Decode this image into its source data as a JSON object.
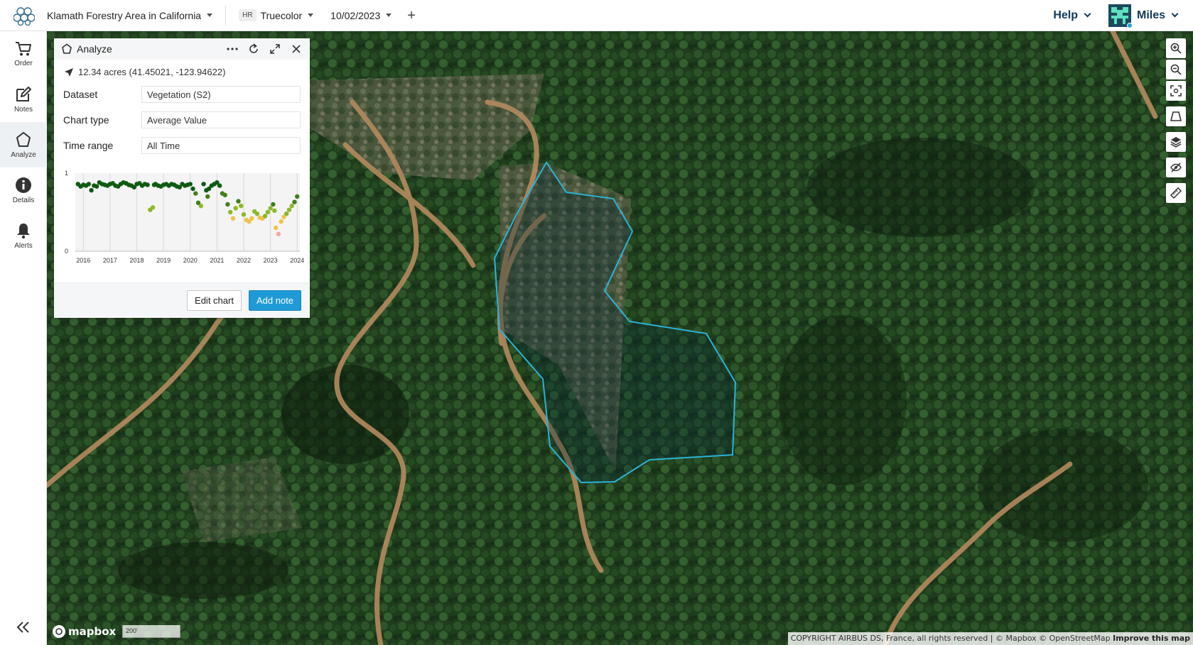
{
  "topbar": {
    "project": "Klamath Forestry Area in California",
    "layer_badge": "HR",
    "layer": "Truecolor",
    "date": "10/02/2023",
    "add_label": "+",
    "help": "Help",
    "user": "Miles"
  },
  "sidebar": {
    "items": [
      {
        "label": "Order",
        "icon": "cart-icon"
      },
      {
        "label": "Notes",
        "icon": "edit-icon"
      },
      {
        "label": "Analyze",
        "icon": "pentagon-icon",
        "active": true
      },
      {
        "label": "Details",
        "icon": "info-icon"
      },
      {
        "label": "Alerts",
        "icon": "bell-icon"
      }
    ],
    "collapse_icon": "double-chevron-left-icon"
  },
  "panel": {
    "title": "Analyze",
    "area": "12.34 acres (41.45021, -123.94622)",
    "fields": [
      {
        "label": "Dataset",
        "value": "Vegetation (S2)"
      },
      {
        "label": "Chart type",
        "value": "Average Value"
      },
      {
        "label": "Time range",
        "value": "All Time"
      }
    ],
    "buttons": {
      "edit": "Edit chart",
      "add_note": "Add note"
    }
  },
  "chart_data": {
    "type": "scatter",
    "title": "",
    "xlabel": "",
    "ylabel": "",
    "xlim": [
      2015.7,
      2024.1
    ],
    "ylim": [
      0,
      1
    ],
    "y_ticks": [
      "0",
      "1"
    ],
    "x_ticks": [
      "2016",
      "2017",
      "2018",
      "2019",
      "2020",
      "2021",
      "2022",
      "2023",
      "2024"
    ],
    "grid": true,
    "colors": {
      "high": "#0f5a12",
      "mid": "#8cb82a",
      "low": "#f0c24a",
      "lowest": "#f5a9a0"
    },
    "x": [
      2015.8,
      2015.9,
      2016.0,
      2016.1,
      2016.2,
      2016.3,
      2016.4,
      2016.5,
      2016.6,
      2016.7,
      2016.8,
      2016.9,
      2017.0,
      2017.1,
      2017.2,
      2017.3,
      2017.4,
      2017.5,
      2017.6,
      2017.7,
      2017.8,
      2017.9,
      2018.0,
      2018.1,
      2018.2,
      2018.3,
      2018.4,
      2018.5,
      2018.6,
      2018.65,
      2018.7,
      2018.8,
      2018.9,
      2019.0,
      2019.1,
      2019.2,
      2019.3,
      2019.4,
      2019.5,
      2019.6,
      2019.7,
      2019.8,
      2019.9,
      2020.0,
      2020.1,
      2020.2,
      2020.3,
      2020.4,
      2020.5,
      2020.6,
      2020.65,
      2020.7,
      2020.8,
      2020.9,
      2021.0,
      2021.1,
      2021.2,
      2021.3,
      2021.4,
      2021.5,
      2021.6,
      2021.7,
      2021.8,
      2021.9,
      2022.0,
      2022.1,
      2022.2,
      2022.3,
      2022.4,
      2022.5,
      2022.6,
      2022.7,
      2022.8,
      2022.9,
      2023.0,
      2023.1,
      2023.15,
      2023.2,
      2023.3,
      2023.4,
      2023.5,
      2023.6,
      2023.7,
      2023.8,
      2023.9,
      2024.0
    ],
    "y": [
      0.86,
      0.83,
      0.85,
      0.84,
      0.86,
      0.78,
      0.84,
      0.83,
      0.88,
      0.86,
      0.85,
      0.84,
      0.86,
      0.87,
      0.84,
      0.83,
      0.86,
      0.88,
      0.87,
      0.85,
      0.84,
      0.82,
      0.86,
      0.87,
      0.84,
      0.86,
      0.85,
      0.53,
      0.56,
      0.85,
      0.86,
      0.84,
      0.83,
      0.85,
      0.86,
      0.84,
      0.86,
      0.85,
      0.83,
      0.82,
      0.86,
      0.84,
      0.85,
      0.86,
      0.8,
      0.74,
      0.62,
      0.58,
      0.86,
      0.78,
      0.7,
      0.8,
      0.84,
      0.86,
      0.88,
      0.84,
      0.74,
      0.72,
      0.6,
      0.5,
      0.42,
      0.55,
      0.64,
      0.58,
      0.47,
      0.4,
      0.38,
      0.42,
      0.51,
      0.48,
      0.43,
      0.42,
      0.45,
      0.5,
      0.55,
      0.6,
      0.52,
      0.3,
      0.22,
      0.38,
      0.44,
      0.48,
      0.53,
      0.58,
      0.63,
      0.7
    ]
  },
  "map": {
    "tools": [
      "zoom-in-icon",
      "zoom-out-icon",
      "fit-bounds-icon",
      "draw-polygon-icon",
      "layers-icon",
      "hide-icon",
      "ruler-icon"
    ],
    "mapbox": "mapbox",
    "scale": "200'",
    "attribution": "COPYRIGHT AIRBUS DS, France, all rights reserved | © Mapbox © OpenStreetMap",
    "improve": "Improve this map",
    "aoi_color": "#2bb3d9"
  }
}
